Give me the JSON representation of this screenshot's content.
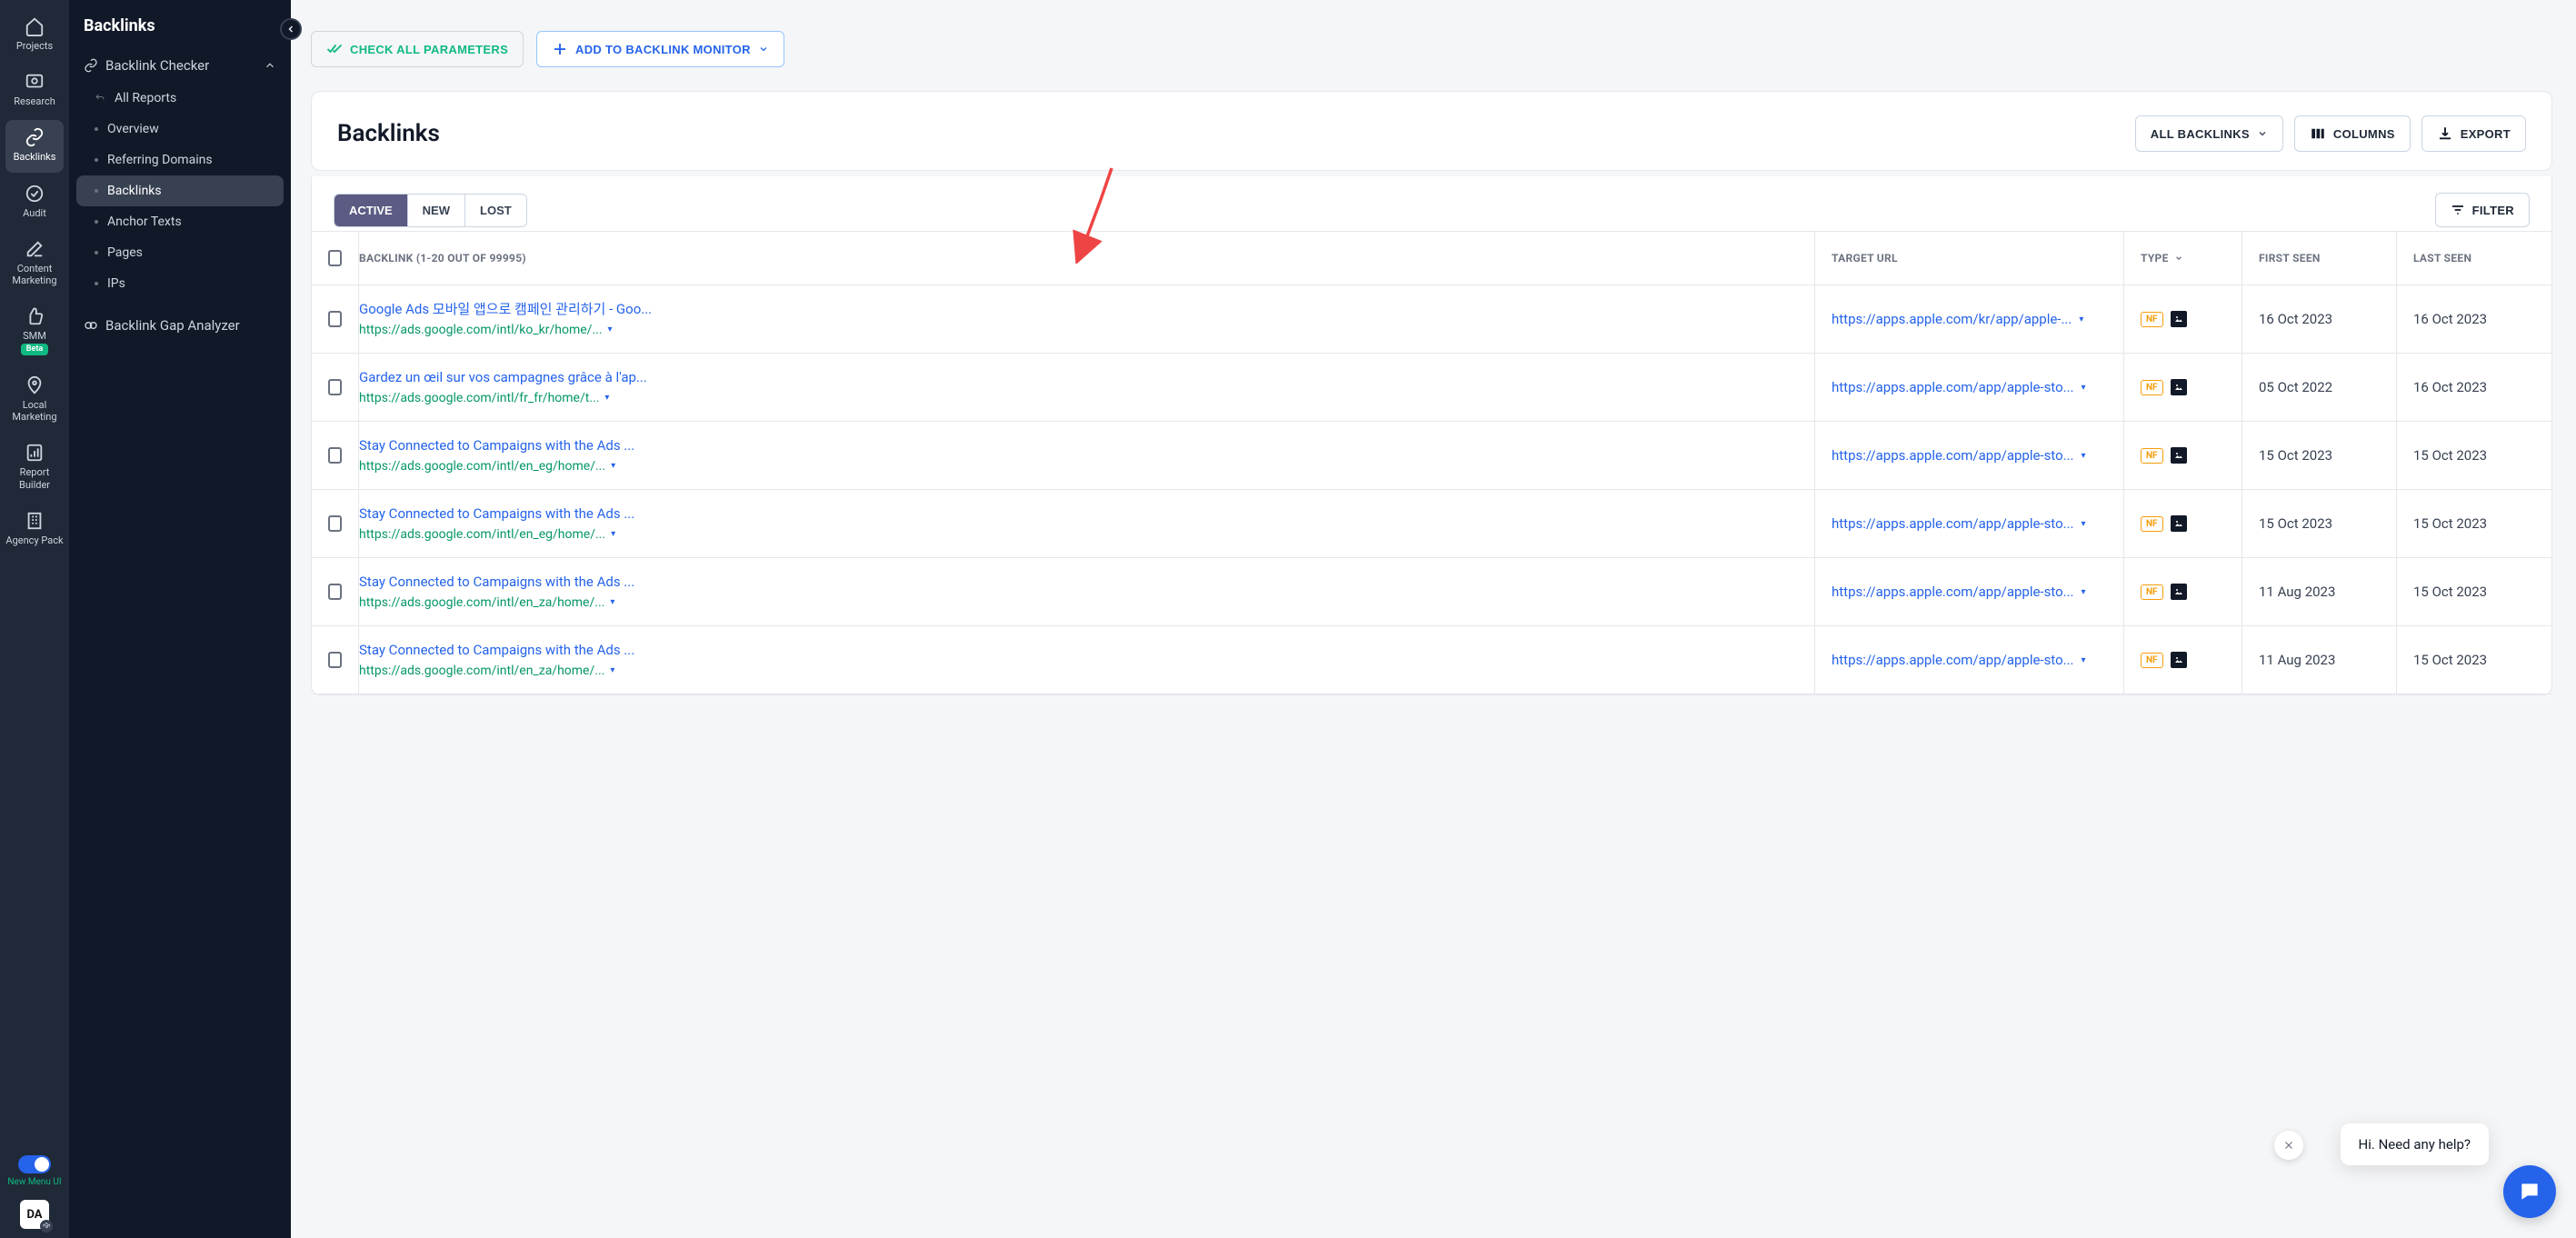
{
  "rail": {
    "items": [
      {
        "label": "Projects"
      },
      {
        "label": "Research"
      },
      {
        "label": "Backlinks"
      },
      {
        "label": "Audit"
      },
      {
        "label": "Content Marketing"
      },
      {
        "label": "SMM",
        "badge": "Beta"
      },
      {
        "label": "Local Marketing"
      },
      {
        "label": "Report Builder"
      },
      {
        "label": "Agency Pack"
      }
    ],
    "toggle_label": "New Menu UI",
    "avatar": "DA"
  },
  "sidebar": {
    "title": "Backlinks",
    "section1": "Backlink Checker",
    "links": [
      {
        "label": "All Reports"
      },
      {
        "label": "Overview"
      },
      {
        "label": "Referring Domains"
      },
      {
        "label": "Backlinks"
      },
      {
        "label": "Anchor Texts"
      },
      {
        "label": "Pages"
      },
      {
        "label": "IPs"
      }
    ],
    "section2": "Backlink Gap Analyzer"
  },
  "toolbar": {
    "check": "CHECK ALL PARAMETERS",
    "add": "ADD TO BACKLINK MONITOR"
  },
  "panel": {
    "title": "Backlinks",
    "all_backlinks": "ALL BACKLINKS",
    "columns": "COLUMNS",
    "export": "EXPORT"
  },
  "tabs": {
    "active": "ACTIVE",
    "new": "NEW",
    "lost": "LOST",
    "filter": "FILTER"
  },
  "table": {
    "header": {
      "backlink": "BACKLINK (1-20 OUT OF 99995)",
      "target": "TARGET URL",
      "type": "TYPE",
      "first": "FIRST SEEN",
      "last": "LAST SEEN"
    },
    "rows": [
      {
        "title": "Google Ads 모바일 앱으로 캠페인 관리하기 - Goo...",
        "url": "https://ads.google.com/intl/ko_kr/home/...",
        "target": "https://apps.apple.com/kr/app/apple-...",
        "nf": "NF",
        "first": "16 Oct 2023",
        "last": "16 Oct 2023"
      },
      {
        "title": "Gardez un œil sur vos campagnes grâce à l'ap...",
        "url": "https://ads.google.com/intl/fr_fr/home/t...",
        "target": "https://apps.apple.com/app/apple-sto...",
        "nf": "NF",
        "first": "05 Oct 2022",
        "last": "16 Oct 2023"
      },
      {
        "title": "Stay Connected to Campaigns with the Ads ...",
        "url": "https://ads.google.com/intl/en_eg/home/...",
        "target": "https://apps.apple.com/app/apple-sto...",
        "nf": "NF",
        "first": "15 Oct 2023",
        "last": "15 Oct 2023"
      },
      {
        "title": "Stay Connected to Campaigns with the Ads ...",
        "url": "https://ads.google.com/intl/en_eg/home/...",
        "target": "https://apps.apple.com/app/apple-sto...",
        "nf": "NF",
        "first": "15 Oct 2023",
        "last": "15 Oct 2023"
      },
      {
        "title": "Stay Connected to Campaigns with the Ads ...",
        "url": "https://ads.google.com/intl/en_za/home/...",
        "target": "https://apps.apple.com/app/apple-sto...",
        "nf": "NF",
        "first": "11 Aug 2023",
        "last": "15 Oct 2023"
      },
      {
        "title": "Stay Connected to Campaigns with the Ads ...",
        "url": "https://ads.google.com/intl/en_za/home/...",
        "target": "https://apps.apple.com/app/apple-sto...",
        "nf": "NF",
        "first": "11 Aug 2023",
        "last": "15 Oct 2023"
      }
    ]
  },
  "chat": {
    "tip": "Hi. Need any help?"
  }
}
